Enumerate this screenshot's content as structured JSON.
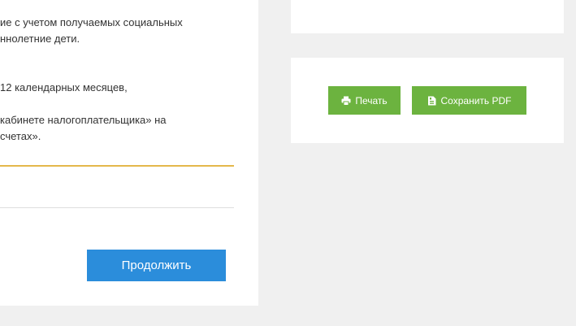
{
  "main": {
    "text_lines": [
      "ие с учетом получаемых социальных",
      "ннолетние дети.",
      "12 календарных месяцев,",
      "кабинете налогоплательщика» на",
      "счетах»."
    ],
    "continue_label": "Продолжить"
  },
  "actions": {
    "print_label": "Печать",
    "print_icon": "printer-icon",
    "pdf_label": "Сохранить PDF",
    "pdf_icon": "file-pdf-icon"
  },
  "colors": {
    "page_background": "#f0f0f0",
    "card_background": "#ffffff",
    "primary_button": "#2b8ddb",
    "action_button": "#6cb33f",
    "accent_divider": "#e4b84b",
    "divider": "#dedede"
  }
}
